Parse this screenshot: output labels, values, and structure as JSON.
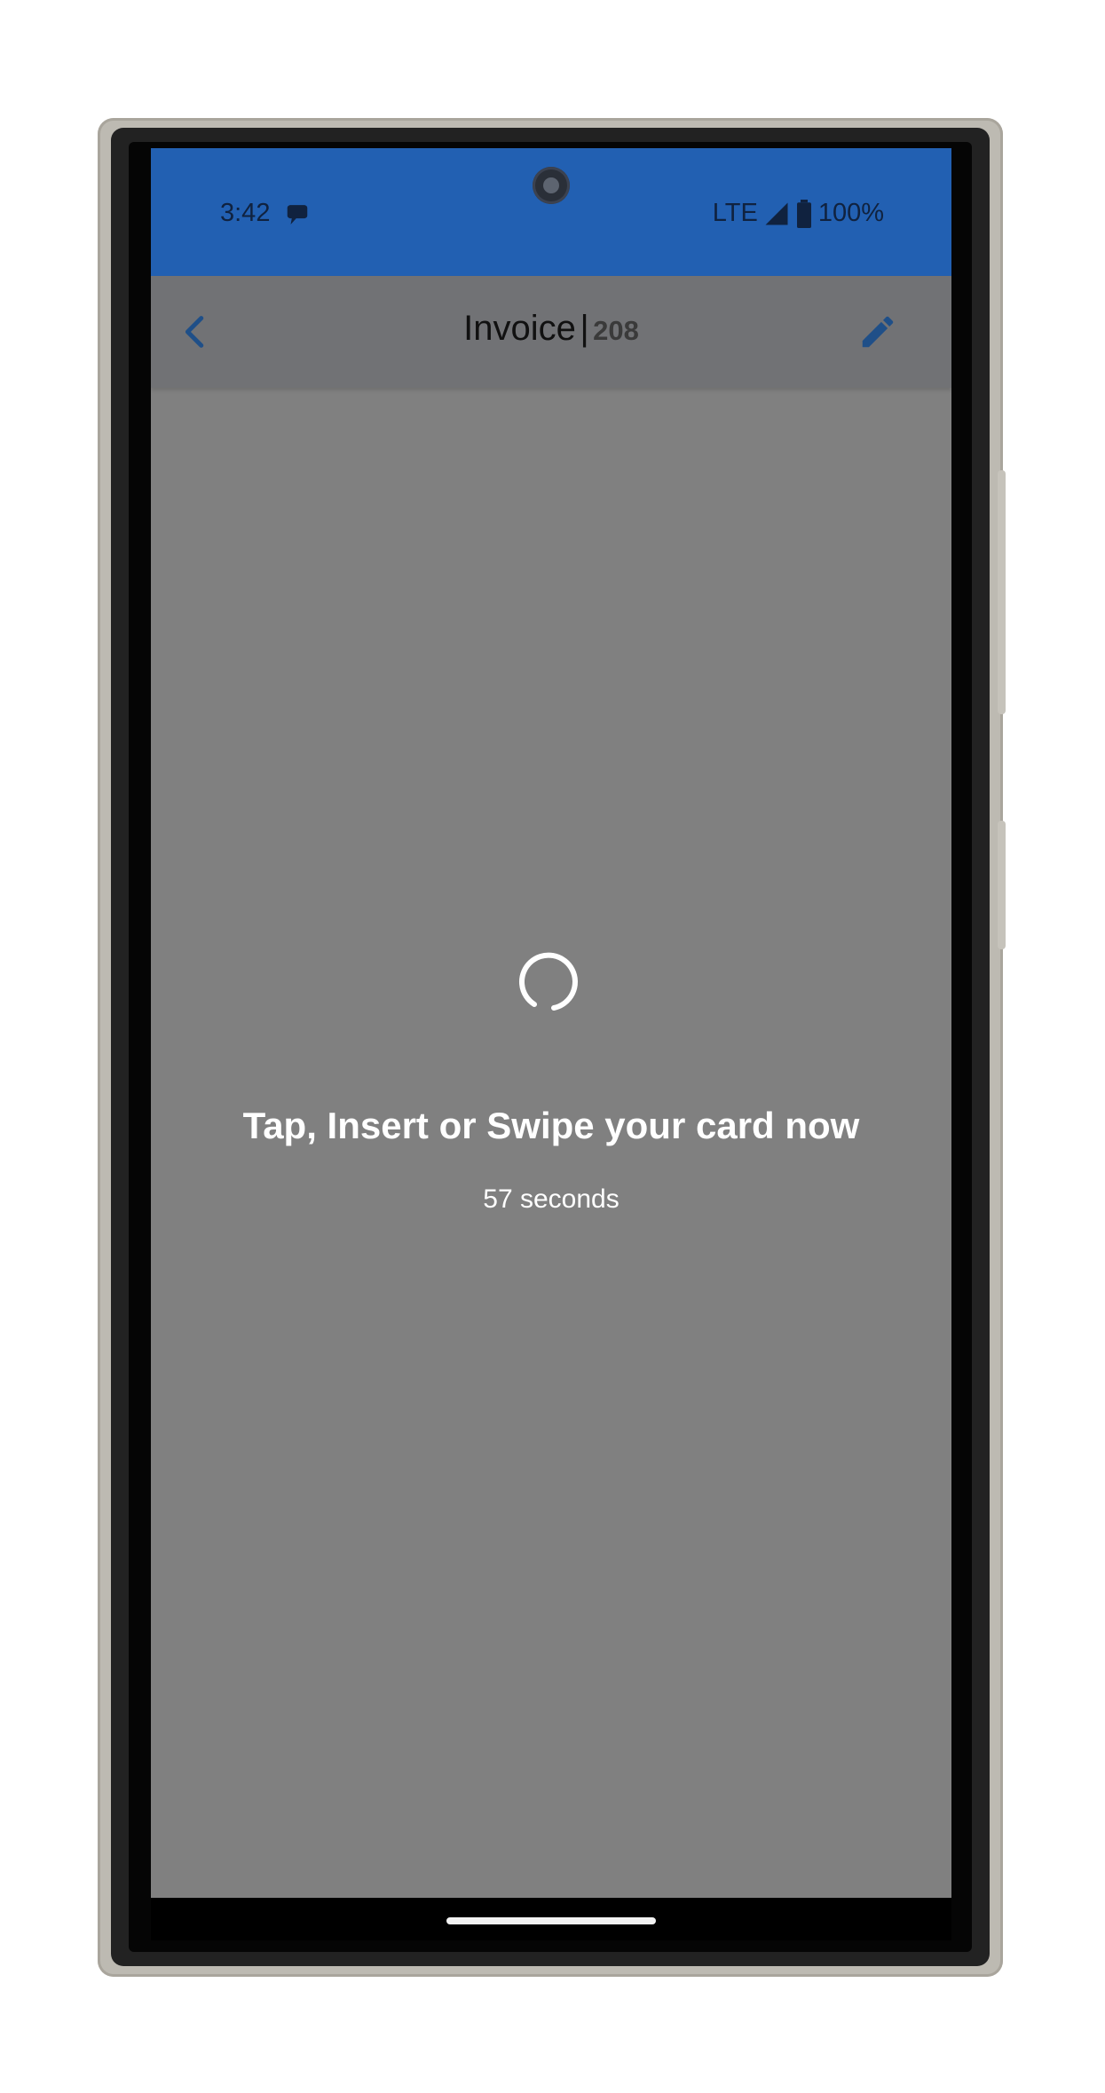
{
  "status_bar": {
    "time": "3:42",
    "network": "LTE",
    "battery": "100%",
    "icons": [
      "message-bubble-icon",
      "signal-icon",
      "battery-icon"
    ]
  },
  "app_bar": {
    "title": "Invoice",
    "separator": "|",
    "invoice_number": "208",
    "back_icon": "chevron-left-icon",
    "edit_icon": "pencil-icon"
  },
  "payment": {
    "prompt": "Tap, Insert or Swipe your card now",
    "countdown": "57 seconds"
  },
  "colors": {
    "status_bar": "#2260b2",
    "app_bar": "#717275",
    "screen_overlay": "#808080",
    "accent": "#1f4f88"
  }
}
